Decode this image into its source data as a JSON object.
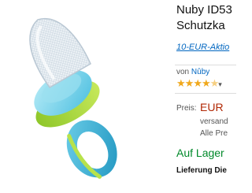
{
  "product": {
    "title_line1": "Nuby ID53",
    "title_line2": "Schutzka",
    "promo_link": "10-EUR-Aktio",
    "brand_prefix": "von",
    "brand_name": "Nûby",
    "rating_stars": 4.5,
    "price_label": "Preis:",
    "price_currency": "EUR",
    "shipping_text": "versand",
    "prices_incl_text": "Alle Pre",
    "availability": "Auf Lager",
    "delivery_text": "Lieferung Die"
  },
  "image": {
    "icon": "fruit-feeder-image",
    "colors": {
      "mesh": "#dde6ee",
      "cap": "#7fd3e8",
      "ring_green": "#a9d635",
      "handle_blue": "#3cb0d8"
    }
  },
  "colors": {
    "link": "#0066c0",
    "price": "#b12704",
    "in_stock": "#00892a",
    "star": "#f0a81c"
  }
}
